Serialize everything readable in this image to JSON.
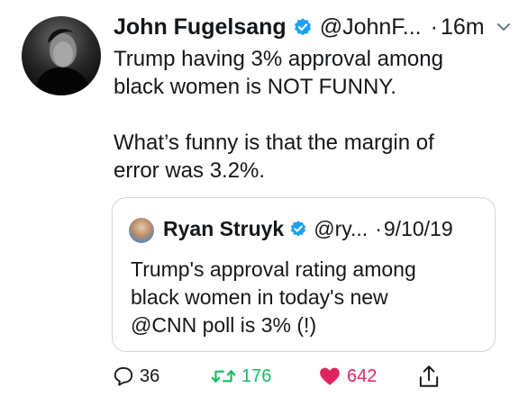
{
  "tweet": {
    "name": "John Fugelsang",
    "handle": "@JohnF...",
    "separator": "·",
    "time": "16m",
    "text": "Trump having 3% approval among\nblack women is NOT FUNNY.\n\nWhat’s funny is that the margin of\nerror was 3.2%."
  },
  "quoted": {
    "name": "Ryan Struyk",
    "handle": "@ry...",
    "separator": "·",
    "date": "9/10/19",
    "text": "Trump's approval rating among\nblack women in today's new\n@CNN poll is 3% (!)"
  },
  "actions": {
    "reply_count": "36",
    "retweet_count": "176",
    "like_count": "642"
  },
  "colors": {
    "verified_blue": "#1da1f2",
    "retweet_green": "#17bf63",
    "like_red": "#e0245e"
  },
  "icons": [
    "verified-icon",
    "chevron-down-icon",
    "reply-icon",
    "retweet-icon",
    "like-icon",
    "share-icon"
  ]
}
